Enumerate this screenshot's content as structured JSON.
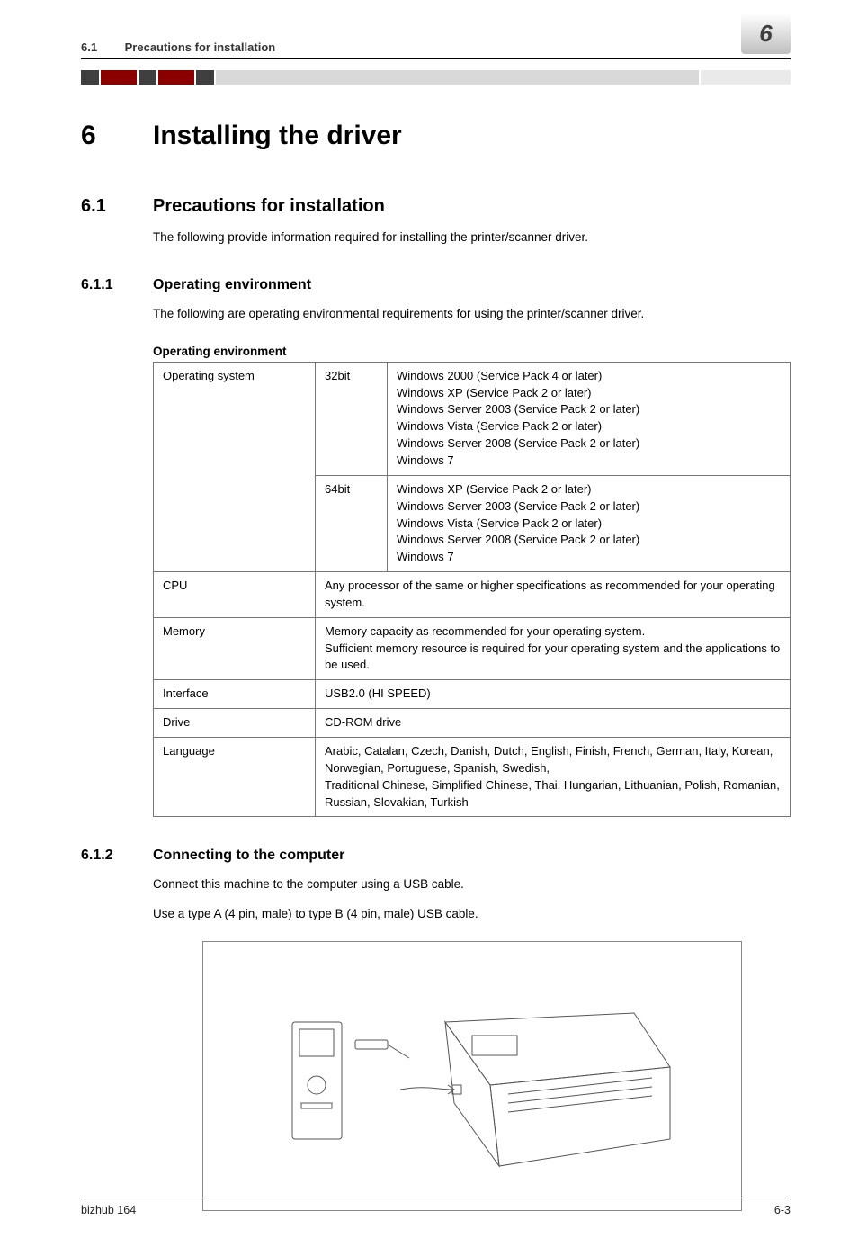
{
  "header": {
    "section_number": "6.1",
    "section_title": "Precautions for installation",
    "chapter_number": "6"
  },
  "chapter": {
    "number": "6",
    "title": "Installing the driver"
  },
  "section": {
    "number": "6.1",
    "title": "Precautions for installation",
    "intro": "The following provide information required for installing the printer/scanner driver."
  },
  "subsec611": {
    "number": "6.1.1",
    "title": "Operating environment",
    "intro": "The following are operating environmental requirements for using the printer/scanner driver.",
    "table_title": "Operating environment",
    "rows": {
      "os_label": "Operating system",
      "os_32_label": "32bit",
      "os_32_value": "Windows 2000 (Service Pack 4 or later)\nWindows XP (Service Pack 2 or later)\nWindows Server 2003 (Service Pack 2 or later)\nWindows Vista (Service Pack 2 or later)\nWindows Server 2008 (Service Pack 2 or later)\nWindows 7",
      "os_64_label": "64bit",
      "os_64_value": "Windows XP (Service Pack 2 or later)\nWindows Server 2003 (Service Pack 2 or later)\nWindows Vista (Service Pack 2 or later)\nWindows Server 2008 (Service Pack 2 or later)\nWindows 7",
      "cpu_label": "CPU",
      "cpu_value": "Any processor of the same or higher specifications as recommended for your operating system.",
      "memory_label": "Memory",
      "memory_value": "Memory capacity as recommended for your operating system.\nSufficient memory resource is required for your operating system and the applications to be used.",
      "interface_label": "Interface",
      "interface_value": "USB2.0 (HI SPEED)",
      "drive_label": "Drive",
      "drive_value": "CD-ROM drive",
      "language_label": "Language",
      "language_value": "Arabic, Catalan, Czech, Danish, Dutch, English, Finish, French, German, Italy, Korean, Norwegian, Portuguese, Spanish, Swedish,\nTraditional Chinese, Simplified Chinese, Thai, Hungarian, Lithuanian, Polish, Romanian, Russian, Slovakian, Turkish"
    }
  },
  "subsec612": {
    "number": "6.1.2",
    "title": "Connecting to the computer",
    "p1": "Connect this machine to the computer using a USB cable.",
    "p2": "Use a type A (4 pin, male) to type B (4 pin, male) USB cable.",
    "diagram_name": "usb-connection-printer-diagram"
  },
  "footer": {
    "left": "bizhub 164",
    "right": "6-3"
  }
}
